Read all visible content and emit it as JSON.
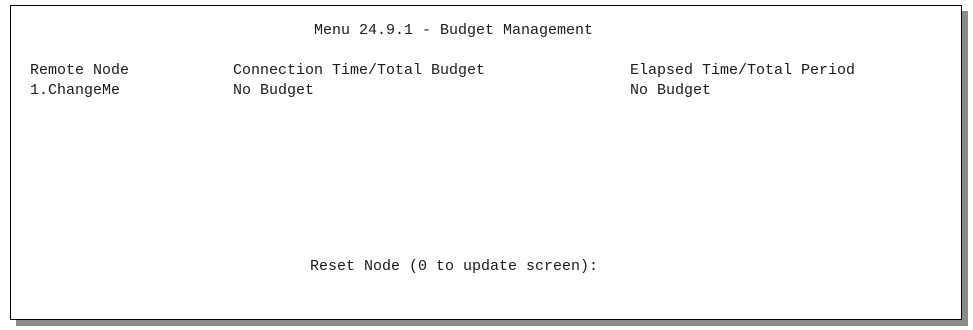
{
  "screen": {
    "title": "Menu 24.9.1 - Budget Management",
    "columns": {
      "remote_node": "Remote Node",
      "connection_time": "Connection Time/Total Budget",
      "elapsed_time": "Elapsed Time/Total Period"
    },
    "rows": [
      {
        "remote_node": "1.ChangeMe",
        "connection_time": "No Budget",
        "elapsed_time": "No Budget"
      }
    ],
    "prompt": "Reset Node (0 to update screen):"
  }
}
